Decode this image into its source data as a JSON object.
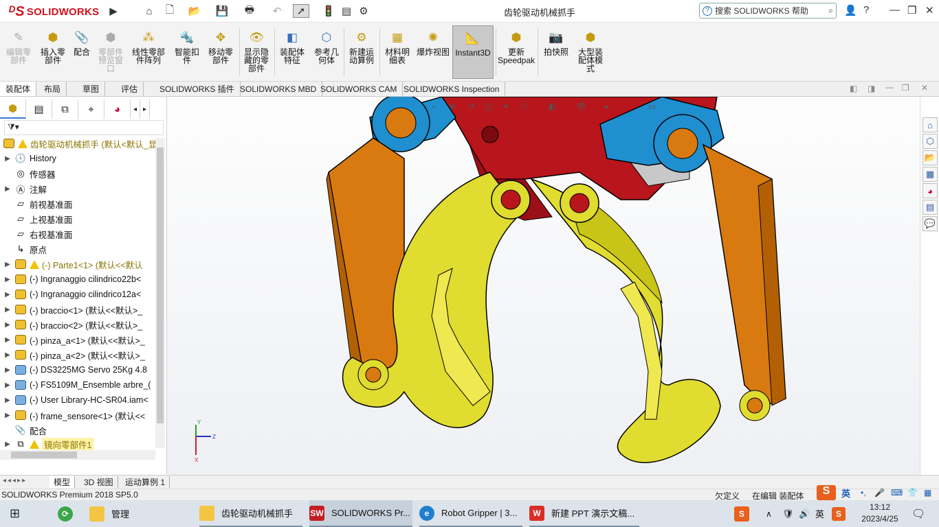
{
  "app": {
    "brand": "SOLIDWORKS",
    "window_title": "齿轮驱动机械抓手"
  },
  "help_search": {
    "placeholder": "搜索 SOLIDWORKS 帮助"
  },
  "window_controls": {
    "user": "👤",
    "help": "?",
    "minimize": "—",
    "restore": "❐",
    "close": "✕"
  },
  "ribbon": {
    "buttons": [
      {
        "label": "编辑零部件",
        "enabled": false,
        "icon": "edit-component-icon"
      },
      {
        "label": "插入零部件",
        "enabled": true,
        "icon": "insert-component-icon"
      },
      {
        "label": "配合",
        "enabled": true,
        "icon": "mate-icon"
      },
      {
        "label": "零部件预览窗口",
        "enabled": false,
        "icon": "component-preview-icon"
      },
      {
        "label": "线性零部件阵列",
        "enabled": true,
        "icon": "linear-pattern-icon"
      },
      {
        "label": "智能扣件",
        "enabled": true,
        "icon": "smart-fasteners-icon"
      },
      {
        "label": "移动零部件",
        "enabled": true,
        "icon": "move-component-icon"
      },
      {
        "label": "显示隐藏的零部件",
        "enabled": true,
        "icon": "show-hidden-icon"
      },
      {
        "label": "装配体特征",
        "enabled": true,
        "icon": "assembly-features-icon"
      },
      {
        "label": "参考几何体",
        "enabled": true,
        "icon": "reference-geometry-icon"
      },
      {
        "label": "新建运动算例",
        "enabled": true,
        "icon": "motion-study-icon"
      },
      {
        "label": "材料明细表",
        "enabled": true,
        "icon": "bom-icon"
      },
      {
        "label": "爆炸视图",
        "enabled": true,
        "icon": "exploded-view-icon"
      },
      {
        "label": "Instant3D",
        "enabled": true,
        "active": true,
        "icon": "instant3d-icon"
      },
      {
        "label": "更新Speedpak",
        "enabled": true,
        "icon": "speedpak-icon"
      },
      {
        "label": "拍快照",
        "enabled": true,
        "icon": "snapshot-icon"
      },
      {
        "label": "大型装配体模式",
        "enabled": true,
        "icon": "large-assembly-icon"
      }
    ]
  },
  "command_tabs": [
    "装配体",
    "布局",
    "草图",
    "评估",
    "SOLIDWORKS 插件",
    "SOLIDWORKS MBD",
    "SOLIDWORKS CAM",
    "SOLIDWORKS Inspection"
  ],
  "feature_tree": {
    "root": "齿轮驱动机械抓手  (默认<默认_显",
    "items": [
      {
        "label": "History",
        "expand": true,
        "icon": "history-icon"
      },
      {
        "label": "传感器",
        "expand": false,
        "icon": "sensor-icon"
      },
      {
        "label": "注解",
        "expand": true,
        "icon": "annotations-icon"
      },
      {
        "label": "前视基准面",
        "expand": false,
        "icon": "plane-icon"
      },
      {
        "label": "上视基准面",
        "expand": false,
        "icon": "plane-icon"
      },
      {
        "label": "右视基准面",
        "expand": false,
        "icon": "plane-icon"
      },
      {
        "label": "原点",
        "expand": false,
        "icon": "origin-icon"
      },
      {
        "label": "(-) Parte1<1> (默认<<默认",
        "expand": true,
        "icon": "part-icon",
        "warning": true
      },
      {
        "label": "(-) Ingranaggio cilindrico22b<",
        "expand": true,
        "icon": "part-icon"
      },
      {
        "label": "(-) Ingranaggio cilindrico12a<",
        "expand": true,
        "icon": "part-icon"
      },
      {
        "label": "(-) braccio<1> (默认<<默认>_",
        "expand": true,
        "icon": "part-icon"
      },
      {
        "label": "(-) braccio<2> (默认<<默认>_",
        "expand": true,
        "icon": "part-icon"
      },
      {
        "label": "(-) pinza_a<1> (默认<<默认>_",
        "expand": true,
        "icon": "part-icon"
      },
      {
        "label": "(-) pinza_a<2> (默认<<默认>_",
        "expand": true,
        "icon": "part-icon"
      },
      {
        "label": "(-) DS3225MG Servo 25Kg 4.8",
        "expand": true,
        "icon": "subassembly-icon"
      },
      {
        "label": "(-) FS5109M_Ensemble arbre_(",
        "expand": true,
        "icon": "subassembly-icon"
      },
      {
        "label": "(-) User Library-HC-SR04.iam<",
        "expand": true,
        "icon": "subassembly-icon"
      },
      {
        "label": "(-) frame_sensore<1> (默认<<",
        "expand": true,
        "icon": "part-icon"
      },
      {
        "label": "配合",
        "expand": false,
        "icon": "mates-icon"
      },
      {
        "label": "镜向零部件1",
        "expand": true,
        "icon": "mirror-icon",
        "warning": true
      }
    ]
  },
  "bottom_tabs": [
    "模型",
    "3D 视图",
    "运动算例 1"
  ],
  "status": {
    "left": "SOLIDWORKS Premium 2018 SP5.0",
    "undefined": "欠定义",
    "editing": "在编辑 装配体"
  },
  "taskbar": {
    "items": [
      {
        "label": "管理",
        "icon": "folder-icon"
      },
      {
        "label": "齿轮驱动机械抓手",
        "icon": "folder-icon"
      },
      {
        "label": "SOLIDWORKS Pr...",
        "icon": "solidworks-icon"
      },
      {
        "label": "Robot Gripper | 3...",
        "icon": "edge-icon"
      },
      {
        "label": "新建 PPT 演示文稿...",
        "icon": "wps-icon"
      }
    ],
    "ime": "英",
    "ime_tray": "英",
    "time": "13:12",
    "date": "2023/4/25"
  },
  "colors": {
    "gripper_yellow": "#e0dc30",
    "arm_orange": "#d87a10",
    "body_red": "#b8161c",
    "link_blue": "#1f8fd0",
    "ribbon_bg": "#f3f3f3"
  }
}
